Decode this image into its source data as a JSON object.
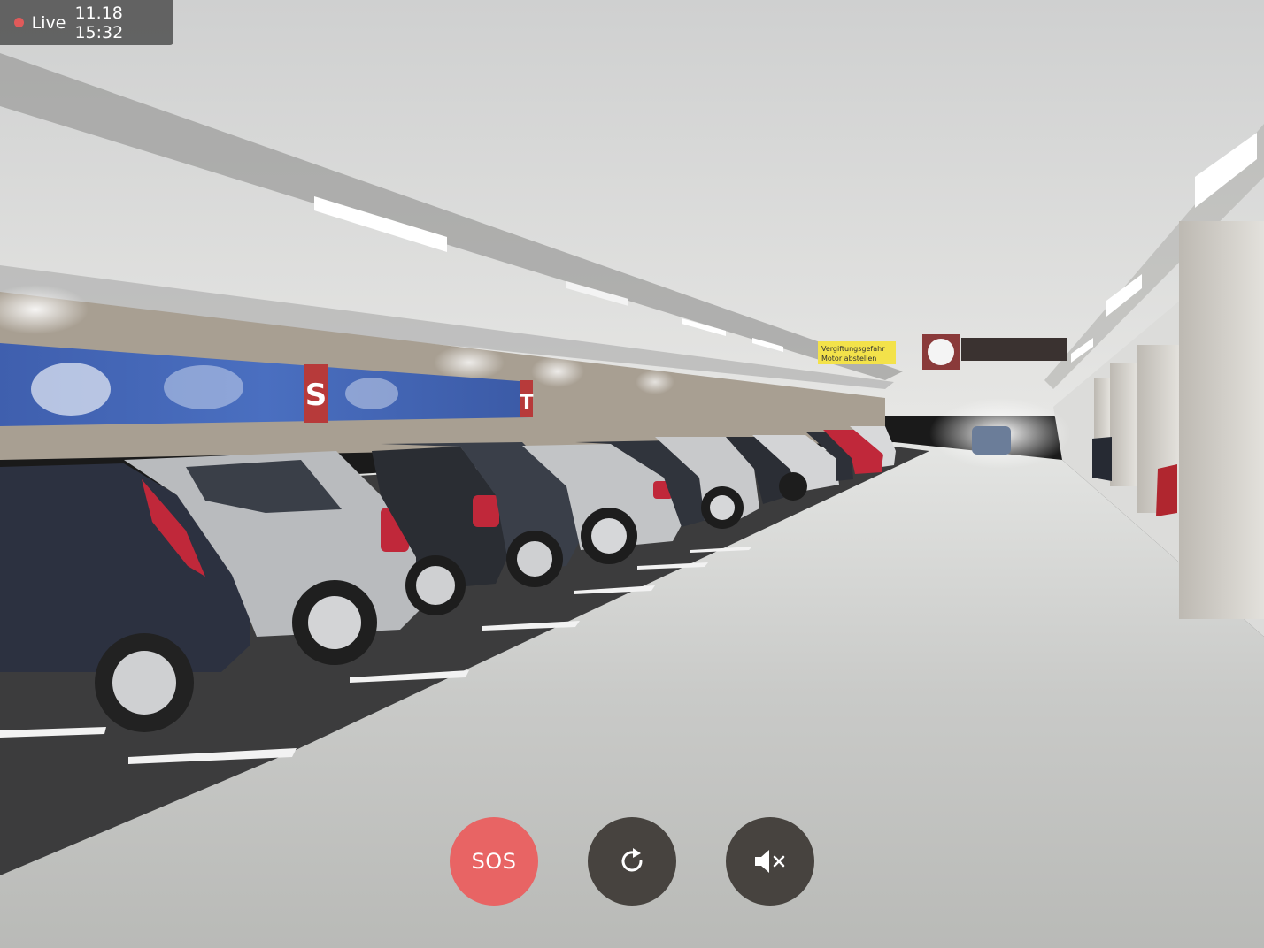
{
  "status": {
    "live_label": "Live",
    "timestamp": "11.18 15:32",
    "indicator_color": "#e05a5a"
  },
  "scene": {
    "signage_line1": "Vergiftungsgefahr",
    "signage_line2": "Motor abstellen",
    "wall_letter_1": "S",
    "wall_letter_2": "T"
  },
  "controls": {
    "sos_label": "SOS",
    "sos_color": "#e86464",
    "refresh_icon": "refresh-icon",
    "mute_icon": "volume-mute-icon",
    "button_color": "#47433f"
  }
}
